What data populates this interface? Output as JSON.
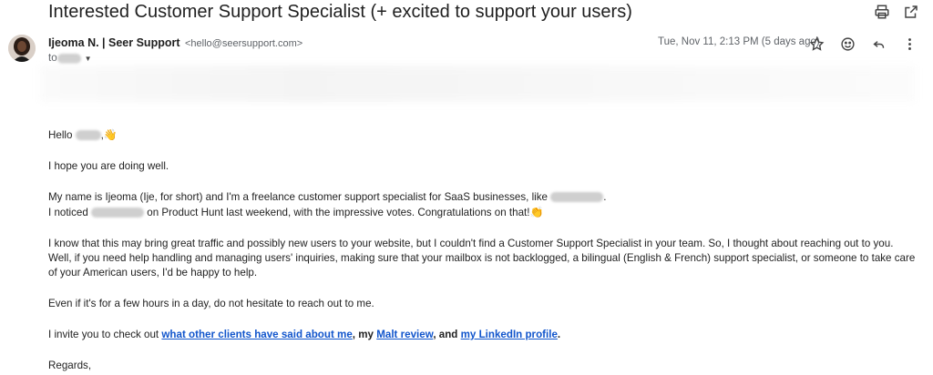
{
  "email": {
    "subject": "Interested Customer Support Specialist (+ excited to support your users)",
    "sender_name": "Ijeoma N. | Seer Support",
    "sender_email": "<hello@seersupport.com>",
    "to_label": "to",
    "date": "Tue, Nov 11, 2:13 PM (5 days ago)"
  },
  "icons": {
    "print": "print-icon",
    "open_new": "open-in-new-icon",
    "star": "star-icon",
    "emoji": "emoji-reaction-icon",
    "reply": "reply-icon",
    "more": "more-vert-icon"
  },
  "body": {
    "greeting": "Hello",
    "greeting_comma": ",",
    "wave": "👋",
    "line1": "I hope you are doing well.",
    "line2a": "My name is Ijeoma (Ije, for short) and I'm a freelance customer support specialist for SaaS businesses, like",
    "line2a_end": ".",
    "line2b_start": "I noticed",
    "line2b_end": "on Product Hunt last weekend, with the impressive votes. Congratulations on that!",
    "clap": "👏",
    "line3a": "I know that this may bring great traffic and possibly new users to your website, but I couldn't find a Customer Support Specialist in your team. So, I thought about reaching out to you.",
    "line3b": "Well, if you need help handling and managing users' inquiries, making sure that your mailbox is not backlogged, a bilingual (English & French) support specialist, or someone to take care of your American users, I'd be happy to help.",
    "line4": "Even if it's for a few hours in a day, do not hesitate to reach out to me.",
    "line5_start": "I invite you to check out",
    "link1": "what other clients have said about me",
    "sep1": ", my",
    "link2": "Malt review",
    "sep2": ", and",
    "link3": "my LinkedIn profile",
    "line5_end": ".",
    "signoff": "Regards,"
  }
}
